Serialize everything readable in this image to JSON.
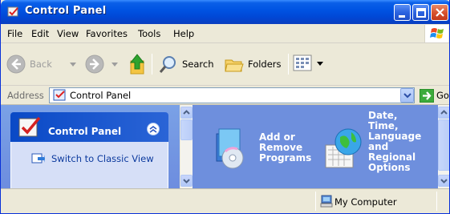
{
  "window": {
    "title": "Control Panel"
  },
  "menubar": {
    "items": [
      {
        "label": "File"
      },
      {
        "label": "Edit"
      },
      {
        "label": "View"
      },
      {
        "label": "Favorites"
      },
      {
        "label": "Tools"
      },
      {
        "label": "Help"
      }
    ]
  },
  "toolbar": {
    "back_label": "Back",
    "search_label": "Search",
    "folders_label": "Folders"
  },
  "address": {
    "label": "Address",
    "value": "Control Panel",
    "go_label": "Go"
  },
  "left_pane": {
    "box_title": "Control Panel",
    "link_label": "Switch to Classic View"
  },
  "categories": [
    {
      "label_lines": [
        "Add or",
        "Remove",
        "Programs"
      ],
      "icon": "add-remove-programs-icon"
    },
    {
      "label_lines": [
        "Date,",
        "Time,",
        "Language",
        "and",
        "Regional",
        "Options"
      ],
      "icon": "date-time-language-icon"
    }
  ],
  "statusbar": {
    "location": "My Computer"
  },
  "colors": {
    "titlebar": "#0054e3",
    "left_pane": "#7aa1e6",
    "right_pane": "#6e8fdd",
    "link": "#0c3a9e"
  }
}
